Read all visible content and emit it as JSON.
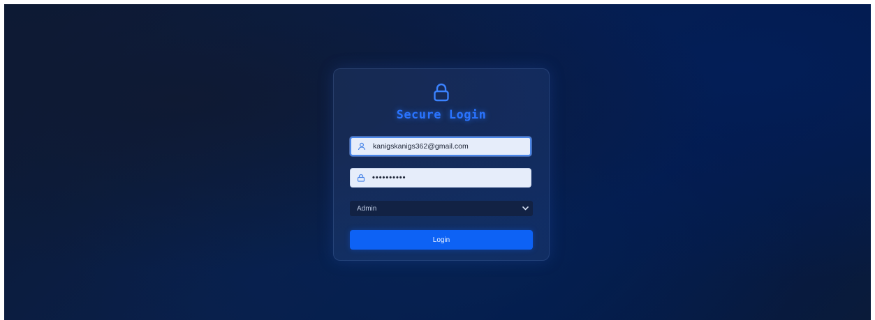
{
  "login_card": {
    "title": "Secure Login",
    "icon": "lock-icon",
    "email": {
      "value": "kanigskanigs362@gmail.com",
      "icon": "user-icon"
    },
    "password": {
      "value": "••••••••••",
      "icon": "lock-icon"
    },
    "role_select": {
      "selected": "Admin",
      "icon": "chevron-down-icon"
    },
    "submit_label": "Login"
  },
  "colors": {
    "accent": "#0d62f5",
    "title_glow": "#2a74ff",
    "input_bg": "#e6edfa",
    "select_bg": "#122244"
  }
}
